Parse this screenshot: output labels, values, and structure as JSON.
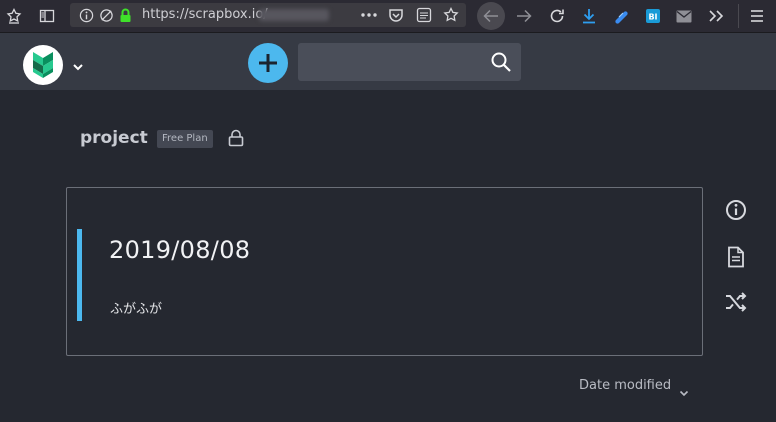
{
  "browser": {
    "url": "https://scrapbox.io/",
    "icons": [
      "library-icon",
      "sidebar-icon",
      "info-icon",
      "tracking-protection-icon",
      "lock-icon",
      "more-icon",
      "pocket-icon",
      "reader-icon",
      "bookmark-star-icon",
      "back-icon",
      "forward-icon",
      "reload-icon",
      "download-icon",
      "extension-icon",
      "extension-bi-icon",
      "mail-icon",
      "overflow-icon",
      "menu-icon"
    ]
  },
  "header": {
    "logo_icon": "scrapbox-logo-icon",
    "new_page_icon": "plus-icon",
    "search_placeholder": "",
    "search_icon": "search-icon"
  },
  "project": {
    "name": "project",
    "plan": "Free Plan",
    "privacy_icon": "lock-icon"
  },
  "card": {
    "title": "2019/08/08",
    "description": "ふがふが",
    "accent_color": "#4cb8ee"
  },
  "side_actions": [
    "info-icon",
    "page-icon",
    "shuffle-icon"
  ],
  "sort": {
    "label": "Date modified"
  },
  "colors": {
    "background": "#252830",
    "header": "#363a44",
    "accent": "#4cb8ee"
  }
}
